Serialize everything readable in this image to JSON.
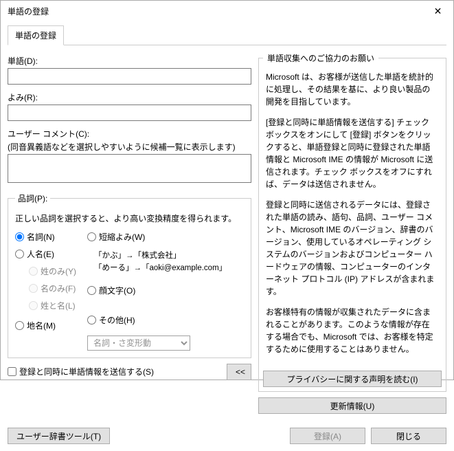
{
  "window": {
    "title": "単語の登録"
  },
  "tabs": {
    "main": "単語の登録"
  },
  "left": {
    "word_label": "単語(D):",
    "word_value": "",
    "yomi_label": "よみ(R):",
    "yomi_value": "",
    "comment_label": "ユーザー コメント(C):",
    "comment_hint": "(同音異義語などを選択しやすいように候補一覧に表示します)",
    "comment_value": "",
    "pos": {
      "legend": "品詞(P):",
      "hint": "正しい品詞を選択すると、より高い変換精度を得られます。",
      "noun": "名詞(N)",
      "person": "人名(E)",
      "last_only": "姓のみ(Y)",
      "first_only": "名のみ(F)",
      "full_name": "姓と名(L)",
      "place": "地名(M)",
      "short_yomi": "短縮よみ(W)",
      "example1": "「かぶ」→「株式会社」",
      "example2": "「めーる」→「aoki@example.com」",
      "kaomoji": "顔文字(O)",
      "other": "その他(H)",
      "combo_placeholder": "名詞・さ変形動"
    },
    "send_checkbox": "登録と同時に単語情報を送信する(S)",
    "expand": "<<"
  },
  "right": {
    "legend": "単語収集へのご協力のお願い",
    "p1": "Microsoft は、お客様が送信した単語を統計的に処理し、その結果を基に、より良い製品の開発を目指しています。",
    "p2": "[登録と同時に単語情報を送信する] チェック ボックスをオンにして [登録] ボタンをクリックすると、単語登録と同時に登録された単語情報と Microsoft IME の情報が Microsoft に送信されます。チェック ボックスをオフにすれば、データは送信されません。",
    "p3": "登録と同時に送信されるデータには、登録された単語の読み、語句、品詞、ユーザー コメント、Microsoft IME のバージョン、辞書のバージョン、使用しているオペレーティング システムのバージョンおよびコンピューター ハードウェアの情報、コンピューターのインターネット プロトコル (IP) アドレスが含まれます。",
    "p4": "お客様特有の情報が収集されたデータに含まれることがあります。このような情報が存在する場合でも、Microsoft では、お客様を特定するために使用することはありません。",
    "privacy_btn": "プライバシーに関する声明を読む(I)",
    "update_btn": "更新情報(U)"
  },
  "footer": {
    "dict_tool": "ユーザー辞書ツール(T)",
    "register": "登録(A)",
    "close": "閉じる"
  }
}
